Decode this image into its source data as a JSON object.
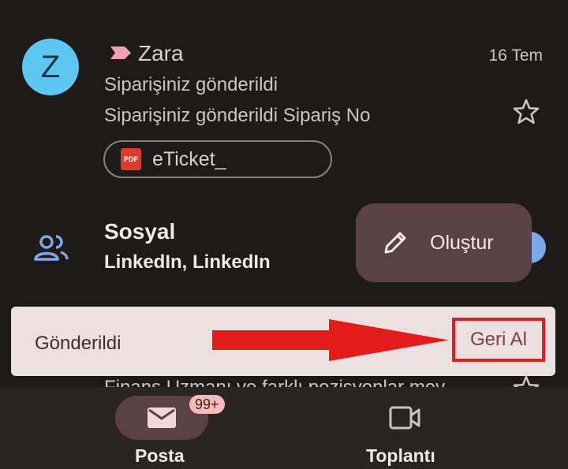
{
  "email": {
    "avatar_letter": "Z",
    "sender": "Zara",
    "date": "16 Tem",
    "subject": "Siparişiniz gönderildi",
    "snippet": "Siparişiniz gönderildi Sipariş No",
    "attachment": {
      "type_label": "PDF",
      "name": "eTicket_"
    }
  },
  "category": {
    "title": "Sosyal",
    "senders": "LinkedIn, LinkedIn"
  },
  "compose": {
    "label": "Oluştur"
  },
  "snackbar": {
    "message": "Gönderildi",
    "action_label": "Geri Al"
  },
  "hidden_row": {
    "text": "Finans Uzmanı ve farklı pozisyonlar mev"
  },
  "bottom_nav": {
    "items": [
      {
        "label": "Posta",
        "badge": "99+"
      },
      {
        "label": "Toplantı"
      }
    ]
  },
  "colors": {
    "accent": "#5ec7f1",
    "highlight": "#e02020",
    "compose_bg": "#5a4146"
  }
}
